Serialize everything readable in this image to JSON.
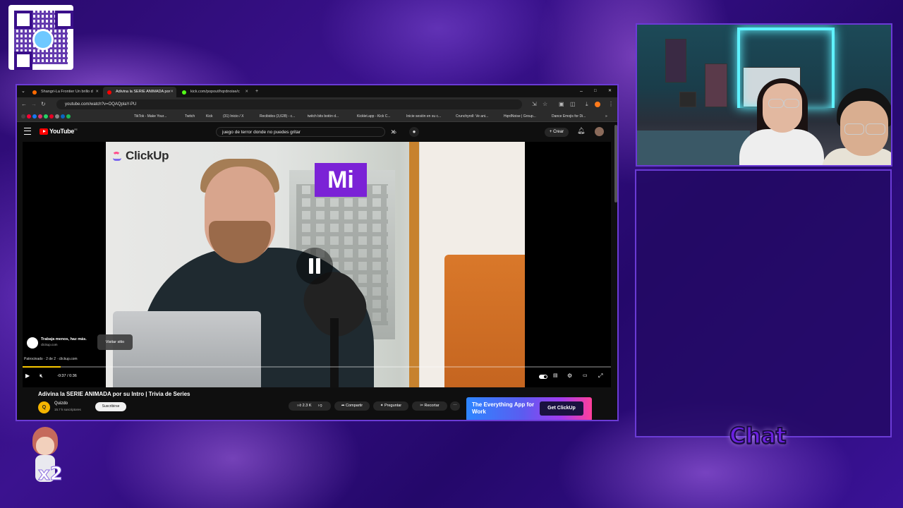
{
  "browser": {
    "tabs": [
      {
        "label": "Shangri-La Frontier Un brillo d",
        "color": "#ff6a00"
      },
      {
        "label": "Adivina la SERIE ANIMADA por",
        "color": "#ff0000"
      },
      {
        "label": "kick.com/popout/hqrdnoise/c",
        "color": "#53fc18"
      }
    ],
    "new_tab": "+",
    "window_controls": [
      "–",
      "□",
      "✕"
    ],
    "url": "youtube.com/watch?v=OQAQplaY-PU",
    "bookmarks": [
      "TikTok - Make Your...",
      "Twitch",
      "Kick",
      "(31) Inicio / X",
      "Recibidos (3,628) - c...",
      "twitch bits botón d...",
      "Kicklet.app - Kick C...",
      "Inicie sesión en su c...",
      "Crunchyroll: Ve ani...",
      "HqrdNoise | Group...",
      "Dance Emojis for Di..."
    ]
  },
  "youtube": {
    "logo": "YouTube",
    "region": "PE",
    "search_query": "juego de terror donde no puedes gritar",
    "create_label": "Crear",
    "video": {
      "brand": "ClickUp",
      "overlay_text": "Mi"
    },
    "ad": {
      "title": "Trabaja menos, haz más.",
      "domain": "clickup.com",
      "visit_label": "Visitar sitio",
      "sponsored": "Patrocinado · 2 de 2 · clickup.com"
    },
    "progress": 0.065,
    "time": "-0:37 / 0:36",
    "title": "Adivina la SERIE ANIMADA por su Intro | Trivia de Series",
    "channel": {
      "name": "Quizdo",
      "initial": "Q",
      "subscribers": "15.7 k suscriptores"
    },
    "subscribe_label": "Suscribirse",
    "likes": "2.3 K",
    "share_label": "Compartir",
    "ask_label": "Preguntar",
    "clip_label": "Recortar",
    "more_label": "⋯",
    "banner": {
      "text": "The Everything App for Work",
      "button": "Get ClickUp"
    }
  },
  "overlay": {
    "chat_label": "Chat",
    "multiplier": "x2"
  },
  "colors": {
    "frame": "#6b3bd6",
    "progress": "#f9c800",
    "youtube_red": "#ff0000"
  }
}
